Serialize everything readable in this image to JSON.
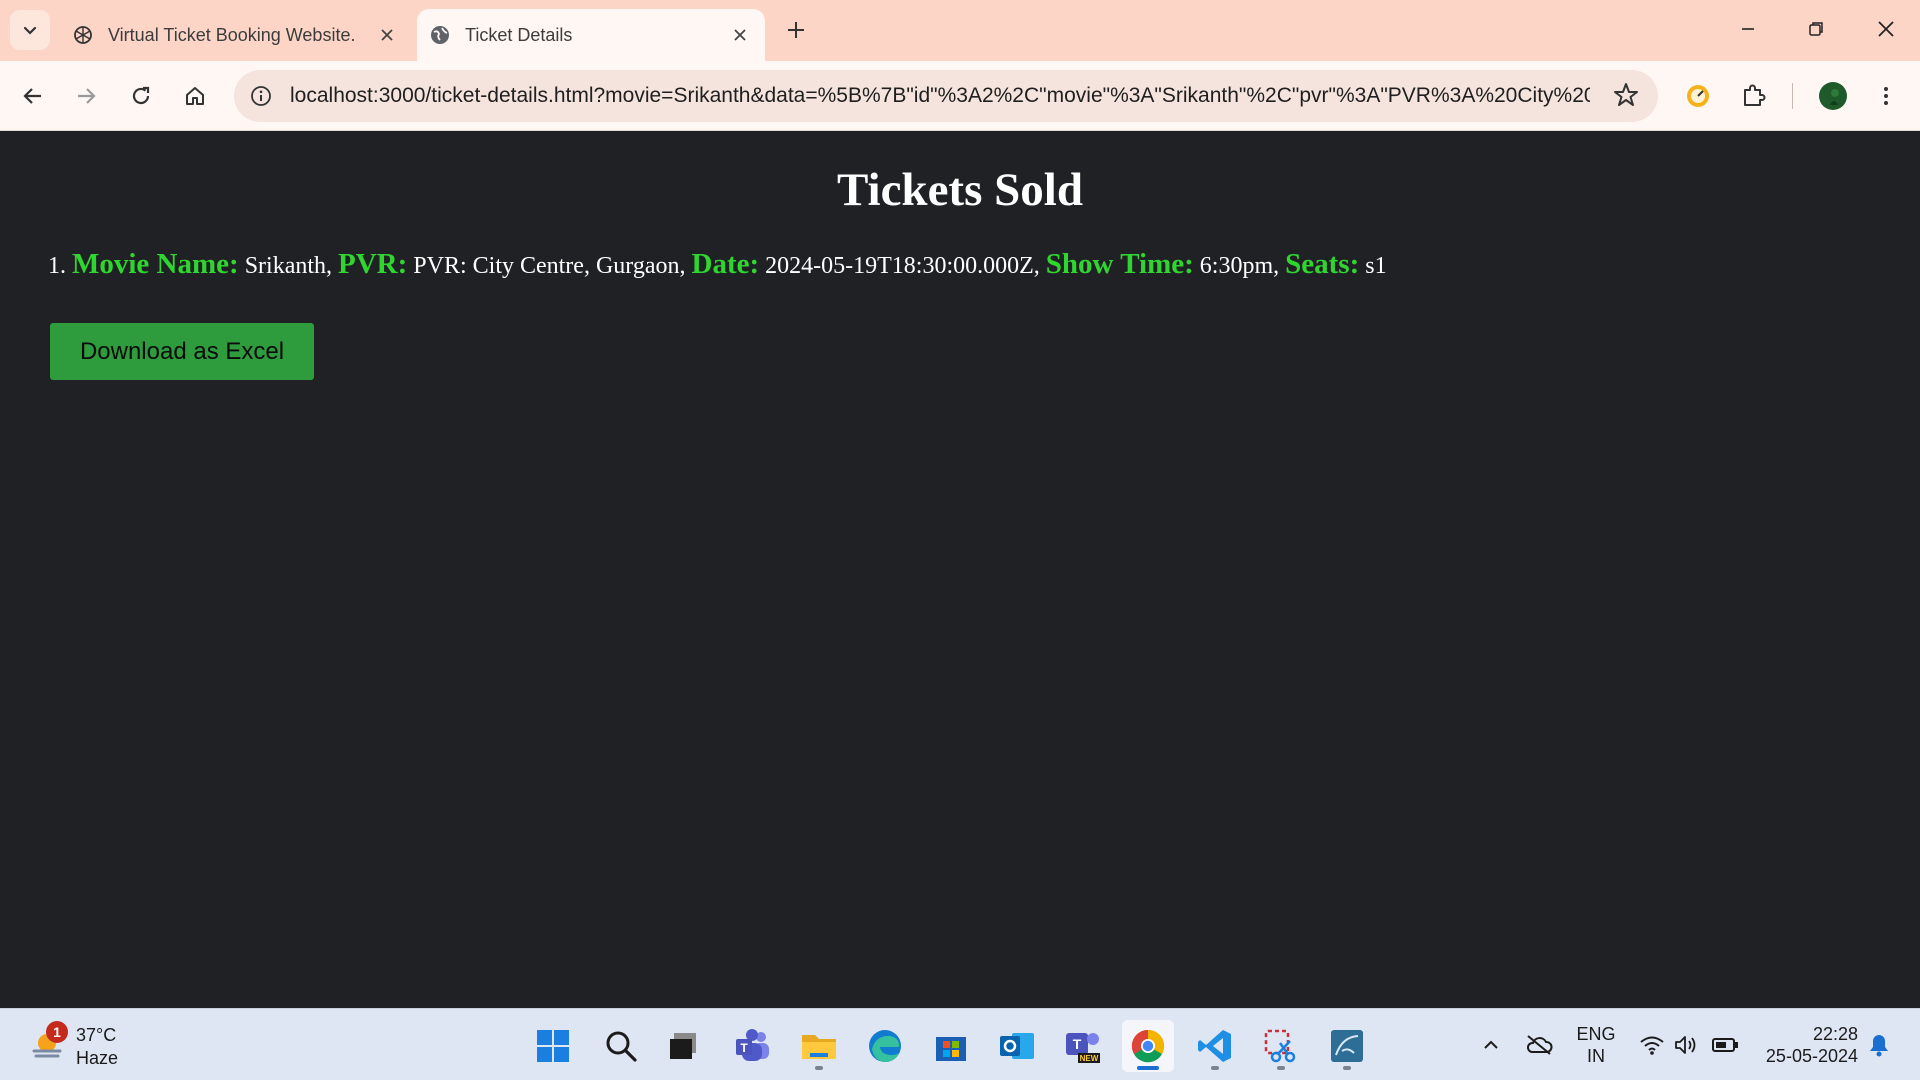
{
  "browser": {
    "tabs": [
      {
        "title": "Virtual Ticket Booking Website.",
        "active": false
      },
      {
        "title": "Ticket Details",
        "active": true
      }
    ],
    "url": "localhost:3000/ticket-details.html?movie=Srikanth&data=%5B%7B\"id\"%3A2%2C\"movie\"%3A\"Srikanth\"%2C\"pvr\"%3A\"PVR%3A%20City%20..."
  },
  "page": {
    "title": "Tickets Sold",
    "tickets": [
      {
        "index": "1.",
        "movie_label": "Movie Name:",
        "movie": "Srikanth,",
        "pvr_label": "PVR:",
        "pvr": "PVR: City Centre, Gurgaon,",
        "date_label": "Date:",
        "date": "2024-05-19T18:30:00.000Z,",
        "time_label": "Show Time:",
        "time": "6:30pm,",
        "seats_label": "Seats:",
        "seats": "s1"
      }
    ],
    "download_label": "Download as Excel"
  },
  "colors": {
    "label_green": "#2fd62f",
    "button_green": "#2e9b3d",
    "page_bg": "#202124",
    "tabstrip_bg": "#fcd5c7"
  },
  "taskbar": {
    "weather": {
      "badge": "1",
      "temp": "37°C",
      "condition": "Haze"
    },
    "apps": [
      "windows-start-icon",
      "search-icon",
      "task-view-icon",
      "teams-icon",
      "file-explorer-icon",
      "edge-icon",
      "microsoft-store-icon",
      "outlook-icon",
      "teams-new-icon",
      "chrome-icon",
      "vscode-icon",
      "snipping-tool-icon",
      "mysql-workbench-icon"
    ],
    "lang_line1": "ENG",
    "lang_line2": "IN",
    "time": "22:28",
    "date": "25-05-2024"
  }
}
